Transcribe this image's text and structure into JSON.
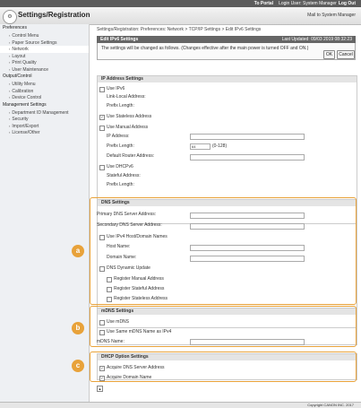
{
  "topbar": {
    "portal": "To Portal",
    "login_user": "Login User: System Manager",
    "logout": "Log Out"
  },
  "header": {
    "title": "Settings/Registration",
    "mail": "Mail to System Manager"
  },
  "sidebar": {
    "sec1": "Preferences",
    "sec1_items": [
      "Control Menu",
      "Paper Source Settings",
      "Network",
      "Layout",
      "Print Quality",
      "User Maintenance"
    ],
    "sec2": "Output/Control",
    "sec2_items": [
      "Utility Menu",
      "Calibration",
      "Device Control"
    ],
    "sec3": "Management Settings",
    "sec3_items": [
      "Department ID Management",
      "Security",
      "Import/Export",
      "License/Other"
    ]
  },
  "breadcrumb": "Settings/Registration: Preferences: Network > TCP/IP Settings > Edit IPv6 Settings",
  "title": {
    "label": "Edit IPv6 Settings",
    "updated": "Last Updated: 09/03 2019 08:32:23"
  },
  "notice": "The settings will be changed as follows. (Changes effective after the main power is turned OFF and ON.)",
  "buttons": {
    "ok": "OK",
    "cancel": "Cancel"
  },
  "ip": {
    "header": "IP Address Settings",
    "use_ipv6": "Use IPv6",
    "link_local": "Link-Local Address:",
    "prefix_length": "Prefix Length:",
    "use_stateless": "Use Stateless Address",
    "use_manual": "Use Manual Address",
    "ip_address": "IP Address:",
    "prefix_length2": "Prefix Length:",
    "prefix_value": "64",
    "prefix_range": "(0-128)",
    "default_router": "Default Router Address:",
    "use_dhcpv6": "Use DHCPv6",
    "stateful": "Stateful Address:",
    "prefix_length3": "Prefix Length:"
  },
  "dns": {
    "header": "DNS Settings",
    "primary": "Primary DNS Server Address:",
    "secondary": "Secondary DNS Server Address:",
    "use_ipv4_host": "Use IPv4 Host/Domain Names",
    "host_name": "Host Name:",
    "domain_name": "Domain Name:",
    "dynamic_update": "DNS Dynamic Update",
    "reg_manual": "Register Manual Address",
    "reg_stateful": "Register Stateful Address",
    "reg_stateless": "Register Stateless Address"
  },
  "mdns": {
    "header": "mDNS Settings",
    "use_mdns": "Use mDNS",
    "same_name": "Use Same mDNS Name as IPv4",
    "name_label": "mDNS Name:"
  },
  "dhcp": {
    "header": "DHCP Option Settings",
    "acquire_dns": "Acquire DNS Server Address",
    "acquire_domain": "Acquire Domain Name"
  },
  "callouts": [
    "a",
    "b",
    "c"
  ],
  "footer": "Copyright CANON INC. 2017",
  "colors": {
    "highlight": "#e8a23a",
    "titlebar": "#666666"
  }
}
